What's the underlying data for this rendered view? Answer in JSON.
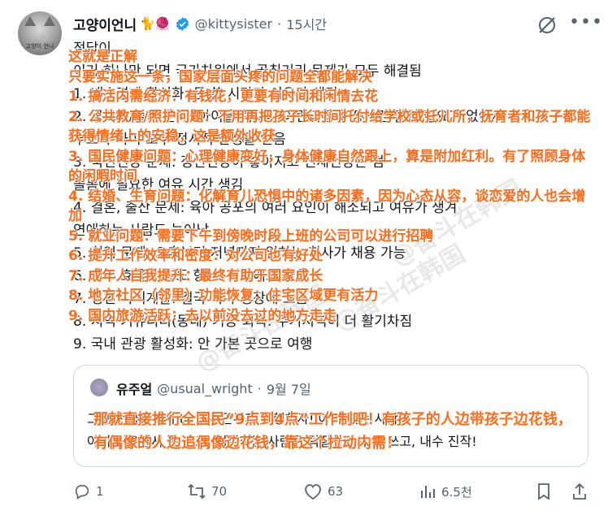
{
  "tweet": {
    "author_name": "고양이언니",
    "author_emojis": "🐈🧶",
    "handle": "@kittysister",
    "separator": "·",
    "time": "15시간",
    "avatar_caption": "고양이 언니",
    "korean_lines": [
      "정답이",
      "이거 하나만 되면 국가차원에서 골칫거리 문제가 모두 해결됨",
      "1. 내수경제 활성화: 돈 쓸 시간과 여유가 생김",
      "2. 공교육/돌봄 문제: 아이를 학교나 어린이집에 장시간 맡길 필요가 없어져",
      "   부모와 아이 모두 정서적 안정을 얻음",
      "3. 국민건강 문제: 정신건강이 좋아지고 신체건강은 덤",
      "   돌봄에 필요한 여유 시간 생김",
      "4. 결혼, 출산 문제: 육아 공포의 여러 요인이 해소되고 여유가 생겨",
      "   연애하는 사람도 늘어남",
      "5. 취업 문제: 오후부터 저녁까지 일하는 회사가 채용 가능",
      "6. 업무 효율과 밀도 향상: 회사에도 좋음",
      "7. 성인 자기계발: 결국 국가 성장에 도움",
      "8. 지역 커뮤니티(동네) 기능 회복: 주거지역이 더 활기차짐",
      "9. 국내 관광 활성화: 안 가본 곳으로 여행"
    ],
    "translation_lines": [
      "这就是正解",
      "只要实施这一条，国家层面头疼的问题全都能解决",
      "1. 搞活内需经济：有钱花，更要有时间和闲情去花",
      "2. 公共教育/照护问题：不用再把孩子长时间托付给学校或托儿所，抚育者和孩子都能获得情绪上的安稳，这是额外收获",
      "3. 国民健康问题：心理健康变好，身体健康自然跟上，算是附加红利。有了照顾身体的闲暇时间",
      "4. 结婚、生育问题：化解育儿恐惧中的诸多因素，因为心态从容，谈恋爱的人也会增加",
      "5. 就业问题：需要下午到傍晚时段上班的公司可以进行招聘",
      "6. 提升工作效率和密度：对公司也有好处",
      "7. 成年人自我提升：最终有助于国家成长",
      "8. 地方社区（邻里）功能恢复：住宅区域更有活力",
      "9. 国内旅游活跃：去以前没去过的地方走走"
    ],
    "watermark": "@奋斗在韩国"
  },
  "quote": {
    "author_name": "유주얼",
    "handle": "@usual_wright",
    "separator": "·",
    "date": "9월 7일",
    "korean_lines": [
      "그냥 전국민 9시 to 4시 근무제 시행하자! 아이 있는 사람은",
      "아이 키우면서 돈 쓰고, 덕질하는 사람은 덕질하면서 돈 쓰고, 내수 진작!"
    ],
    "translation": "那就直接推行全国民“9点到4点”工作制吧！有孩子的人边带孩子边花钱，有偶像的人边追偶像边花钱，靠这个拉动内需！"
  },
  "actions": {
    "replies": "1",
    "reposts": "70",
    "likes": "63",
    "views": "6.5천"
  },
  "colors": {
    "overlay_text": "#ff6b1a",
    "verified": "#1d9bf0",
    "secondary_text": "#536471"
  }
}
